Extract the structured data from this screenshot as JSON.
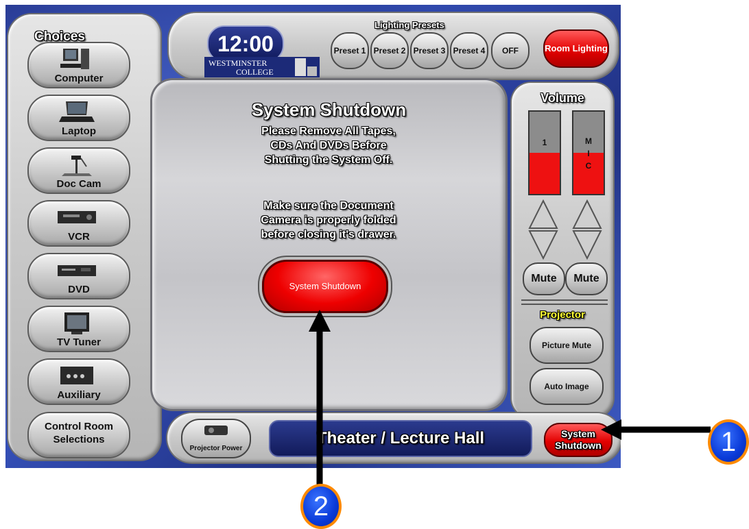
{
  "choices": {
    "title": "Choices",
    "items": [
      {
        "label": "Computer",
        "icon": "computer-icon"
      },
      {
        "label": "Laptop",
        "icon": "laptop-icon"
      },
      {
        "label": "Doc Cam",
        "icon": "document-camera-icon"
      },
      {
        "label": "VCR",
        "icon": "vcr-icon"
      },
      {
        "label": "DVD",
        "icon": "dvd-player-icon"
      },
      {
        "label": "TV Tuner",
        "icon": "tv-icon"
      },
      {
        "label": "Auxiliary",
        "icon": "auxiliary-panel-icon"
      }
    ],
    "control_room": "Control Room Selections"
  },
  "header": {
    "clock": "12:00",
    "logo_text_1": "WESTMINSTER",
    "logo_text_2": "COLLEGE",
    "lighting_title": "Lighting Presets",
    "presets": [
      "Preset 1",
      "Preset 2",
      "Preset 3",
      "Preset 4",
      "OFF"
    ],
    "room_lighting": "Room Lighting"
  },
  "center": {
    "title": "System Shutdown",
    "message1": "Please Remove All Tapes, CDs And DVDs Before Shutting the System Off.",
    "message2": "Make sure the Document Camera is properly folded before closing it's drawer.",
    "shutdown_button": "System Shutdown"
  },
  "volume": {
    "title": "Volume",
    "meters": [
      {
        "label": "1",
        "level": 0.5
      },
      {
        "label": "M I C",
        "level": 0.5
      }
    ],
    "mute": [
      "Mute",
      "Mute"
    ]
  },
  "projector": {
    "title": "Projector",
    "picture_mute": "Picture Mute",
    "auto_image": "Auto Image"
  },
  "footer": {
    "projector_power": "Projector Power",
    "room_name": "Theater / Lecture Hall",
    "shutdown_button": "System Shutdown"
  },
  "callouts": [
    "1",
    "2"
  ],
  "colors": {
    "accent_red": "#e30000",
    "panel_blue": "#2b3f9e",
    "callout_border": "#ff8a00",
    "projector_label": "#ffff33"
  }
}
